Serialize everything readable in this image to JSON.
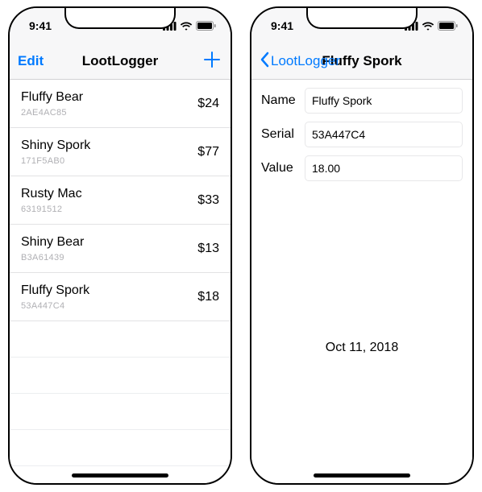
{
  "status": {
    "time": "9:41"
  },
  "list_screen": {
    "nav": {
      "edit": "Edit",
      "title": "LootLogger"
    },
    "items": [
      {
        "name": "Fluffy Bear",
        "serial": "2AE4AC85",
        "price": "$24"
      },
      {
        "name": "Shiny Spork",
        "serial": "171F5AB0",
        "price": "$77"
      },
      {
        "name": "Rusty Mac",
        "serial": "63191512",
        "price": "$33"
      },
      {
        "name": "Shiny Bear",
        "serial": "B3A61439",
        "price": "$13"
      },
      {
        "name": "Fluffy Spork",
        "serial": "53A447C4",
        "price": "$18"
      }
    ]
  },
  "detail_screen": {
    "nav": {
      "back": "LootLogger",
      "title": "Fluffy Spork"
    },
    "labels": {
      "name": "Name",
      "serial": "Serial",
      "value": "Value"
    },
    "fields": {
      "name": "Fluffy Spork",
      "serial": "53A447C4",
      "value": "18.00"
    },
    "date": "Oct 11, 2018"
  }
}
